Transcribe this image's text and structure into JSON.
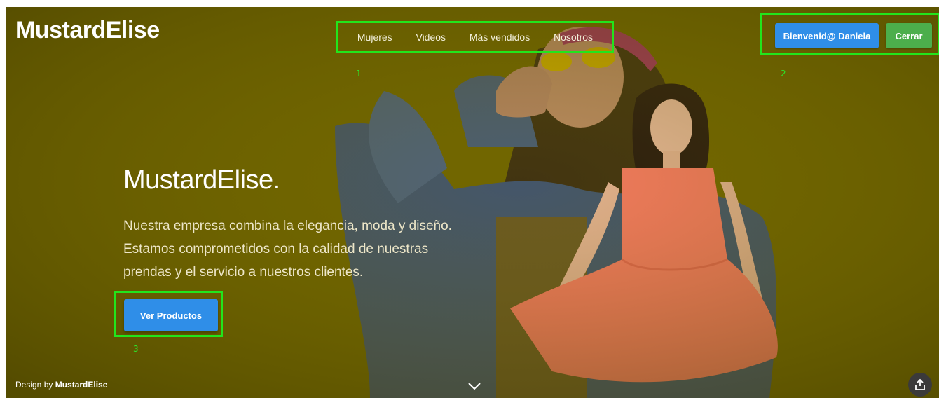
{
  "brand": {
    "logo": "MustardElise"
  },
  "nav": {
    "items": [
      {
        "label": "Mujeres"
      },
      {
        "label": "Videos"
      },
      {
        "label": "Más vendidos"
      },
      {
        "label": "Nosotros"
      }
    ]
  },
  "account": {
    "welcome_label": "Bienvenid@ Daniela",
    "close_label": "Cerrar"
  },
  "hero": {
    "title": "MustardElise.",
    "lines": [
      "Nuestra empresa combina la elegancia, moda y diseño.",
      "Estamos comprometidos con la calidad de nuestras",
      "prendas y el servicio a nuestros clientes."
    ],
    "cta_label": "Ver Productos"
  },
  "annotations": {
    "marker_1": "1",
    "marker_2": "2",
    "marker_3": "3"
  },
  "footer": {
    "credit_prefix": "Design by",
    "credit_brand": "MustardElise"
  },
  "icons": {
    "scroll": "chevron-down-icon",
    "share": "share-icon"
  },
  "colors": {
    "background": "#6e6300",
    "primary_button": "#2f8ee8",
    "close_button": "#4cae4c",
    "annotation": "#22e51c",
    "dress": "#f47a60"
  }
}
